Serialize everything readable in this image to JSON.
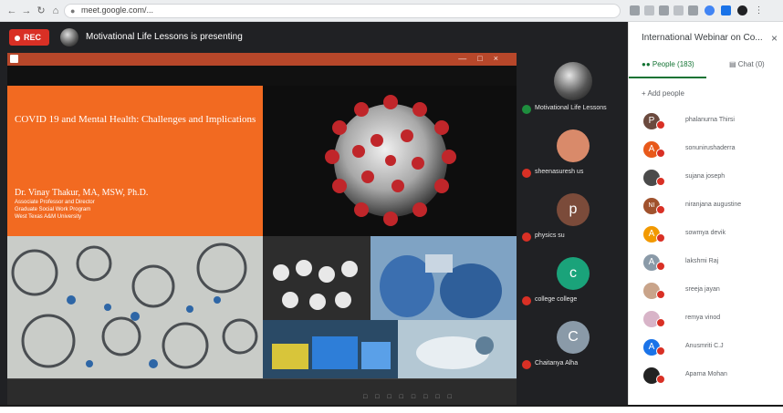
{
  "browser": {
    "url": "meet.google.com/..."
  },
  "meet": {
    "recording_label": "REC",
    "presenting_text": "Motivational Life Lessons is presenting"
  },
  "slide": {
    "title": "COVID 19 and Mental Health: Challenges and Implications",
    "author": "Dr. Vinay Thakur, MA, MSW, Ph.D.",
    "affiliation": [
      "Associate Professor and Director",
      "Graduate Social Work Program",
      "West Texas A&M University"
    ]
  },
  "tiles": [
    {
      "name": "Motivational Life Lessons",
      "initial": "",
      "color": "#555555"
    },
    {
      "name": "sheenasuresh us",
      "initial": "",
      "color": "#d98a6a"
    },
    {
      "name": "physics su",
      "initial": "p",
      "color": "#7b4b3a"
    },
    {
      "name": "college college",
      "initial": "c",
      "color": "#1aa37a"
    },
    {
      "name": "Chaitanya Alha",
      "initial": "C",
      "color": "#8a9aa8"
    }
  ],
  "panel": {
    "title": "International Webinar on Co...",
    "close_icon": "close-icon",
    "tab_people": "People (183)",
    "tab_chat": "Chat (0)",
    "add_people": "Add people",
    "participants": [
      {
        "name": "phalanurna Thirsi",
        "color": "#6b4a3e",
        "initial": "P"
      },
      {
        "name": "sonunirushaderra",
        "color": "#e8591a",
        "initial": "A"
      },
      {
        "name": "sujana joseph",
        "color": "#4a4a4a",
        "initial": ""
      },
      {
        "name": "niranjana augustine",
        "color": "#a0522d",
        "initial": "NI"
      },
      {
        "name": "sowmya devik",
        "color": "#f29900",
        "initial": "A"
      },
      {
        "name": "lakshmi Raj",
        "color": "#8a9aa8",
        "initial": "A"
      },
      {
        "name": "sreeja jayan",
        "color": "#c9a48a",
        "initial": ""
      },
      {
        "name": "remya vinod",
        "color": "#d8b4c8",
        "initial": ""
      },
      {
        "name": "Anusmriti C.J",
        "color": "#1a73e8",
        "initial": "A"
      },
      {
        "name": "Aparna Mohan",
        "color": "#222222",
        "initial": ""
      }
    ]
  },
  "colors": {
    "accent_green": "#137333",
    "mute_red": "#d93025",
    "slide_orange": "#f26a21"
  }
}
